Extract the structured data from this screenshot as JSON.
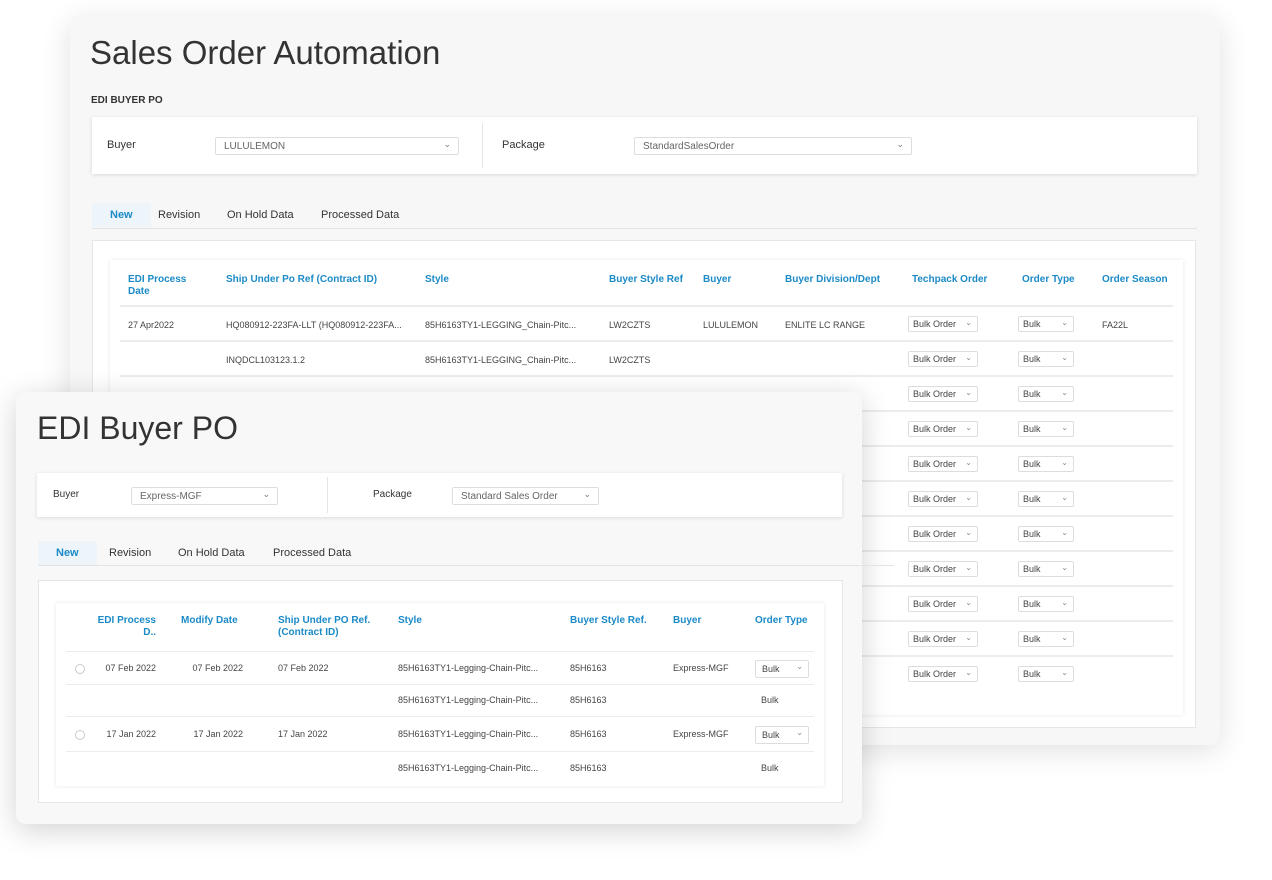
{
  "back": {
    "title": "Sales Order Automation",
    "subtitle": "EDI  BUYER PO",
    "buyer_label": "Buyer",
    "buyer_value": "LULULEMON",
    "package_label": "Package",
    "package_value": "StandardSalesOrder",
    "tabs": [
      "New",
      "Revision",
      "On Hold Data",
      "Processed Data"
    ],
    "headers": [
      "EDI Process Date",
      "Ship Under Po Ref (Contract ID)",
      "Style",
      "Buyer Style Ref",
      "Buyer",
      "Buyer Division/Dept",
      "Techpack Order",
      "Order Type",
      "Order Season"
    ],
    "rows": [
      [
        "27 Apr2022",
        "HQ080912-223FA-LLT (HQ080912-223FA...",
        "85H6163TY1-LEGGING_Chain-Pitc...",
        "LW2CZTS",
        "LULULEMON",
        "ENLITE LC RANGE",
        "Bulk Order",
        "Bulk",
        "FA22L"
      ],
      [
        "",
        "INQDCL103123.1.2",
        "85H6163TY1-LEGGING_Chain-Pitc...",
        "LW2CZTS",
        "",
        "",
        "Bulk Order",
        "Bulk",
        ""
      ],
      [
        "",
        "",
        "",
        "",
        "",
        "",
        "Bulk Order",
        "Bulk",
        ""
      ],
      [
        "",
        "",
        "",
        "",
        "",
        "",
        "Bulk Order",
        "Bulk",
        ""
      ],
      [
        "",
        "",
        "",
        "",
        "",
        "",
        "Bulk Order",
        "Bulk",
        ""
      ],
      [
        "",
        "",
        "",
        "",
        "",
        "",
        "Bulk Order",
        "Bulk",
        ""
      ],
      [
        "",
        "",
        "",
        "",
        "",
        "",
        "Bulk Order",
        "Bulk",
        ""
      ],
      [
        "",
        "",
        "",
        "",
        "",
        "",
        "Bulk Order",
        "Bulk",
        ""
      ],
      [
        "",
        "",
        "",
        "",
        "",
        "",
        "Bulk Order",
        "Bulk",
        ""
      ],
      [
        "",
        "",
        "",
        "",
        "",
        "",
        "Bulk Order",
        "Bulk",
        ""
      ],
      [
        "",
        "",
        "",
        "",
        "",
        "",
        "Bulk Order",
        "Bulk",
        ""
      ]
    ]
  },
  "front": {
    "title": "EDI Buyer PO",
    "buyer_label": "Buyer",
    "buyer_value": "Express-MGF",
    "package_label": "Package",
    "package_value": "Standard Sales Order",
    "tabs": [
      "New",
      "Revision",
      "On Hold Data",
      "Processed Data"
    ],
    "headers": [
      "EDI Process D..",
      "Modify Date",
      "Ship Under PO Ref. (Contract ID)",
      "Style",
      "Buyer Style Ref.",
      "Buyer",
      "Order Type"
    ],
    "rows": [
      {
        "radio": true,
        "cells": [
          "07 Feb 2022",
          "07 Feb 2022",
          "07 Feb 2022",
          "85H6163TY1-Legging-Chain-Pitc...",
          "85H6163",
          "Express-MGF",
          "Bulk"
        ],
        "select": true
      },
      {
        "radio": false,
        "cells": [
          "",
          "",
          "",
          "85H6163TY1-Legging-Chain-Pitc...",
          "85H6163",
          "",
          "Bulk"
        ],
        "select": false
      },
      {
        "radio": true,
        "cells": [
          "17 Jan 2022",
          "17 Jan 2022",
          "17 Jan 2022",
          "85H6163TY1-Legging-Chain-Pitc...",
          "85H6163",
          "Express-MGF",
          "Bulk"
        ],
        "select": true
      },
      {
        "radio": false,
        "cells": [
          "",
          "",
          "",
          "85H6163TY1-Legging-Chain-Pitc...",
          "85H6163",
          "",
          "Bulk"
        ],
        "select": false
      }
    ]
  },
  "colors": {
    "accent": "#1b8ac7"
  }
}
